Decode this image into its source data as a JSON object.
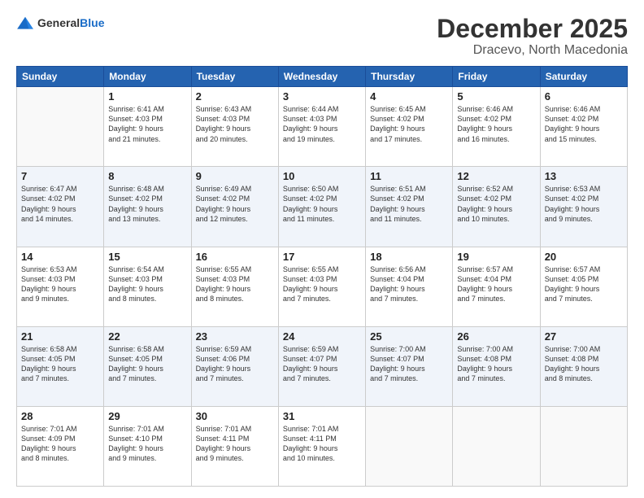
{
  "logo": {
    "general": "General",
    "blue": "Blue"
  },
  "title": "December 2025",
  "subtitle": "Dracevo, North Macedonia",
  "days_of_week": [
    "Sunday",
    "Monday",
    "Tuesday",
    "Wednesday",
    "Thursday",
    "Friday",
    "Saturday"
  ],
  "weeks": [
    [
      {
        "day": "",
        "info": ""
      },
      {
        "day": "1",
        "info": "Sunrise: 6:41 AM\nSunset: 4:03 PM\nDaylight: 9 hours\nand 21 minutes."
      },
      {
        "day": "2",
        "info": "Sunrise: 6:43 AM\nSunset: 4:03 PM\nDaylight: 9 hours\nand 20 minutes."
      },
      {
        "day": "3",
        "info": "Sunrise: 6:44 AM\nSunset: 4:03 PM\nDaylight: 9 hours\nand 19 minutes."
      },
      {
        "day": "4",
        "info": "Sunrise: 6:45 AM\nSunset: 4:02 PM\nDaylight: 9 hours\nand 17 minutes."
      },
      {
        "day": "5",
        "info": "Sunrise: 6:46 AM\nSunset: 4:02 PM\nDaylight: 9 hours\nand 16 minutes."
      },
      {
        "day": "6",
        "info": "Sunrise: 6:46 AM\nSunset: 4:02 PM\nDaylight: 9 hours\nand 15 minutes."
      }
    ],
    [
      {
        "day": "7",
        "info": "Sunrise: 6:47 AM\nSunset: 4:02 PM\nDaylight: 9 hours\nand 14 minutes."
      },
      {
        "day": "8",
        "info": "Sunrise: 6:48 AM\nSunset: 4:02 PM\nDaylight: 9 hours\nand 13 minutes."
      },
      {
        "day": "9",
        "info": "Sunrise: 6:49 AM\nSunset: 4:02 PM\nDaylight: 9 hours\nand 12 minutes."
      },
      {
        "day": "10",
        "info": "Sunrise: 6:50 AM\nSunset: 4:02 PM\nDaylight: 9 hours\nand 11 minutes."
      },
      {
        "day": "11",
        "info": "Sunrise: 6:51 AM\nSunset: 4:02 PM\nDaylight: 9 hours\nand 11 minutes."
      },
      {
        "day": "12",
        "info": "Sunrise: 6:52 AM\nSunset: 4:02 PM\nDaylight: 9 hours\nand 10 minutes."
      },
      {
        "day": "13",
        "info": "Sunrise: 6:53 AM\nSunset: 4:02 PM\nDaylight: 9 hours\nand 9 minutes."
      }
    ],
    [
      {
        "day": "14",
        "info": "Sunrise: 6:53 AM\nSunset: 4:03 PM\nDaylight: 9 hours\nand 9 minutes."
      },
      {
        "day": "15",
        "info": "Sunrise: 6:54 AM\nSunset: 4:03 PM\nDaylight: 9 hours\nand 8 minutes."
      },
      {
        "day": "16",
        "info": "Sunrise: 6:55 AM\nSunset: 4:03 PM\nDaylight: 9 hours\nand 8 minutes."
      },
      {
        "day": "17",
        "info": "Sunrise: 6:55 AM\nSunset: 4:03 PM\nDaylight: 9 hours\nand 7 minutes."
      },
      {
        "day": "18",
        "info": "Sunrise: 6:56 AM\nSunset: 4:04 PM\nDaylight: 9 hours\nand 7 minutes."
      },
      {
        "day": "19",
        "info": "Sunrise: 6:57 AM\nSunset: 4:04 PM\nDaylight: 9 hours\nand 7 minutes."
      },
      {
        "day": "20",
        "info": "Sunrise: 6:57 AM\nSunset: 4:05 PM\nDaylight: 9 hours\nand 7 minutes."
      }
    ],
    [
      {
        "day": "21",
        "info": "Sunrise: 6:58 AM\nSunset: 4:05 PM\nDaylight: 9 hours\nand 7 minutes."
      },
      {
        "day": "22",
        "info": "Sunrise: 6:58 AM\nSunset: 4:05 PM\nDaylight: 9 hours\nand 7 minutes."
      },
      {
        "day": "23",
        "info": "Sunrise: 6:59 AM\nSunset: 4:06 PM\nDaylight: 9 hours\nand 7 minutes."
      },
      {
        "day": "24",
        "info": "Sunrise: 6:59 AM\nSunset: 4:07 PM\nDaylight: 9 hours\nand 7 minutes."
      },
      {
        "day": "25",
        "info": "Sunrise: 7:00 AM\nSunset: 4:07 PM\nDaylight: 9 hours\nand 7 minutes."
      },
      {
        "day": "26",
        "info": "Sunrise: 7:00 AM\nSunset: 4:08 PM\nDaylight: 9 hours\nand 7 minutes."
      },
      {
        "day": "27",
        "info": "Sunrise: 7:00 AM\nSunset: 4:08 PM\nDaylight: 9 hours\nand 8 minutes."
      }
    ],
    [
      {
        "day": "28",
        "info": "Sunrise: 7:01 AM\nSunset: 4:09 PM\nDaylight: 9 hours\nand 8 minutes."
      },
      {
        "day": "29",
        "info": "Sunrise: 7:01 AM\nSunset: 4:10 PM\nDaylight: 9 hours\nand 9 minutes."
      },
      {
        "day": "30",
        "info": "Sunrise: 7:01 AM\nSunset: 4:11 PM\nDaylight: 9 hours\nand 9 minutes."
      },
      {
        "day": "31",
        "info": "Sunrise: 7:01 AM\nSunset: 4:11 PM\nDaylight: 9 hours\nand 10 minutes."
      },
      {
        "day": "",
        "info": ""
      },
      {
        "day": "",
        "info": ""
      },
      {
        "day": "",
        "info": ""
      }
    ]
  ]
}
